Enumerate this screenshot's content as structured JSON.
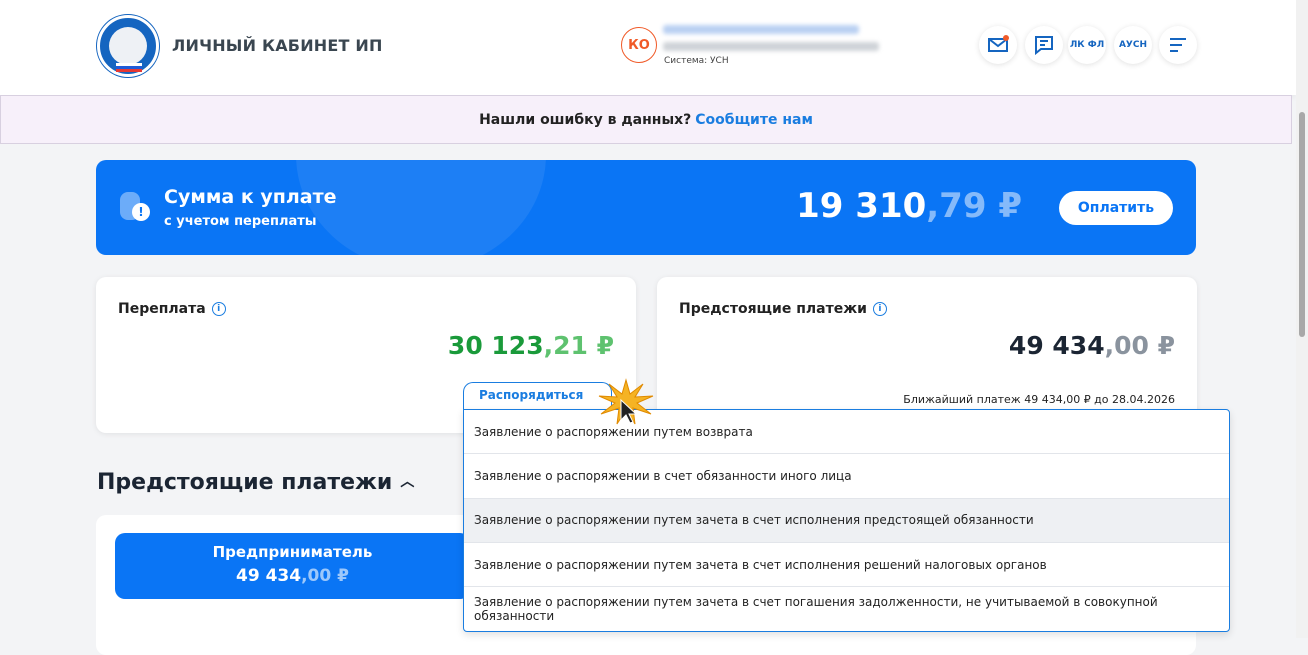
{
  "header": {
    "brand": "ЛИЧНЫЙ КАБИНЕТ ИП",
    "avatar_initials": "КО",
    "system": "Система: УСН",
    "buttons": {
      "lkfl": "ЛК ФЛ",
      "ausn": "АУСН"
    }
  },
  "notice": {
    "text": "Нашли ошибку в данных?",
    "link": "Сообщите нам"
  },
  "banner": {
    "title": "Сумма к уплате",
    "subtitle": "с учетом переплаты",
    "amount_int": "19 310",
    "amount_frac": ",79 ₽",
    "pay_label": "Оплатить"
  },
  "overpay": {
    "title": "Переплата",
    "amount_int": "30 123",
    "amount_frac": ",21 ₽",
    "action_label": "Распорядиться"
  },
  "upcoming": {
    "title": "Предстоящие платежи",
    "amount_int": "49 434",
    "amount_frac": ",00 ₽",
    "next": "Ближайший платеж 49 434,00 ₽ до 28.04.2026"
  },
  "section": {
    "title": "Предстоящие платежи",
    "tab_label": "Предприниматель",
    "tab_amount_int": "49 434",
    "tab_amount_frac": ",00 ₽"
  },
  "menu": [
    "Заявление о распоряжении путем возврата",
    "Заявление о распоряжении в счет обязанности иного лица",
    "Заявление о распоряжении путем зачета в счет исполнения предстоящей обязанности",
    "Заявление о распоряжении путем зачета в счет исполнения решений налоговых органов",
    "Заявление о распоряжении путем зачета в счет погашения задолженности, не учитываемой в совокупной обязанности"
  ]
}
